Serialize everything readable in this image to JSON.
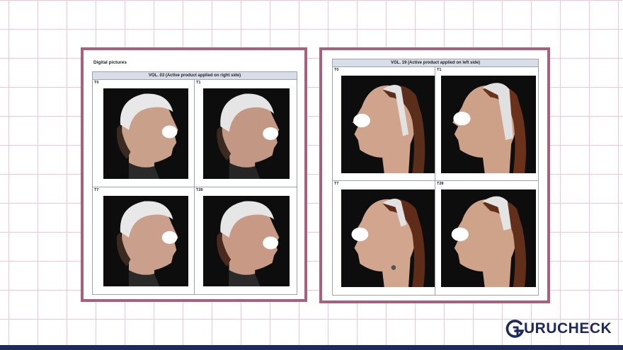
{
  "left_doc": {
    "heading": "Digital pictures",
    "title": "VOL. 03 (Active product applied on right side)",
    "cells": [
      {
        "label": "T0"
      },
      {
        "label": "T1"
      },
      {
        "label": "T7"
      },
      {
        "label": "T28"
      }
    ]
  },
  "right_doc": {
    "title": "VOL. 19 (Active product applied on left side)",
    "cells": [
      {
        "label": "T0"
      },
      {
        "label": "T1"
      },
      {
        "label": "T7"
      },
      {
        "label": "T28"
      }
    ]
  },
  "brand": {
    "name": "URUCHECK",
    "mark_letter": "G",
    "color": "#1f2a5c"
  },
  "colors": {
    "frame": "#a8607e",
    "grid_lines": "#f0c4d6",
    "footer": "#1f2a5c",
    "header_fill": "#d9dde8"
  }
}
